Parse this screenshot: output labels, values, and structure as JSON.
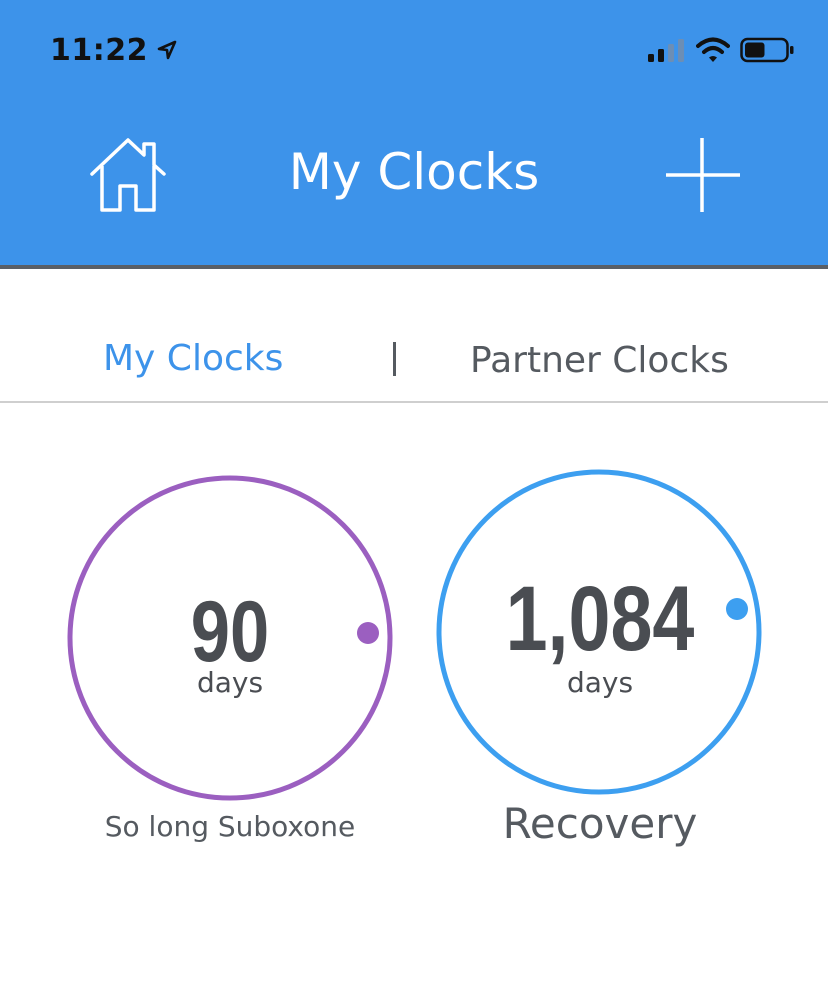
{
  "status_bar": {
    "time": "11:22",
    "location_icon": "location-arrow-icon",
    "signal_icon": "cellular-signal-icon",
    "wifi_icon": "wifi-icon",
    "battery_icon": "battery-icon",
    "battery_level": 0.5
  },
  "header": {
    "title": "My Clocks",
    "home_icon": "home-icon",
    "add_icon": "plus-icon",
    "background_color": "#3d93ea"
  },
  "tabs": {
    "active": "My Clocks",
    "items": [
      {
        "label": "My Clocks",
        "active": true
      },
      {
        "label": "Partner Clocks",
        "active": false
      }
    ],
    "separator": "|"
  },
  "clocks": [
    {
      "value": "90",
      "unit": "days",
      "label": "So long Suboxone",
      "color": "#9b5fc0"
    },
    {
      "value": "1,084",
      "unit": "days",
      "label": "Recovery",
      "color": "#3d9ff0"
    }
  ],
  "colors": {
    "accent": "#3d93ea",
    "text_dark": "#4a4d52",
    "text_muted": "#555a60"
  }
}
